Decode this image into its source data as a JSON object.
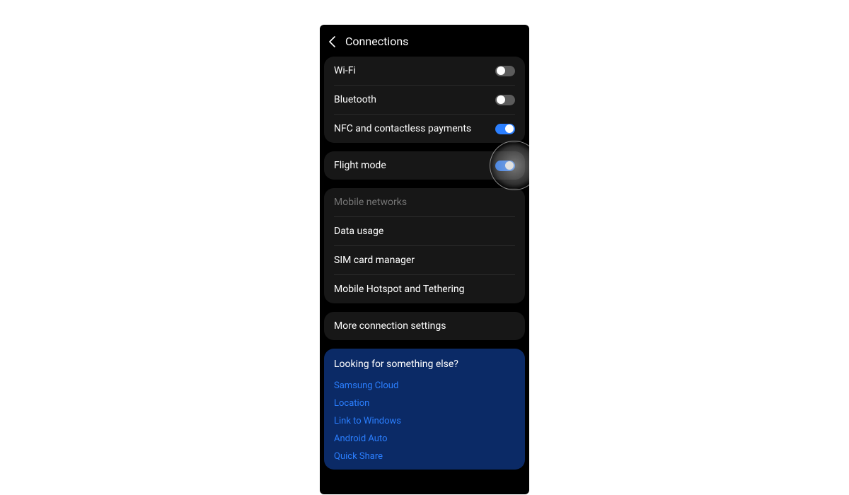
{
  "header": {
    "title": "Connections"
  },
  "groups": [
    {
      "rows": [
        {
          "label": "Wi-Fi",
          "toggle": true,
          "checked": false
        },
        {
          "label": "Bluetooth",
          "toggle": true,
          "checked": false
        },
        {
          "label": "NFC and contactless payments",
          "toggle": true,
          "checked": true
        }
      ]
    },
    {
      "rows": [
        {
          "label": "Flight mode",
          "toggle": true,
          "checked": true,
          "highlight": true
        }
      ]
    },
    {
      "rows": [
        {
          "label": "Mobile networks",
          "toggle": false,
          "disabled": true
        },
        {
          "label": "Data usage",
          "toggle": false
        },
        {
          "label": "SIM card manager",
          "toggle": false
        },
        {
          "label": "Mobile Hotspot and Tethering",
          "toggle": false
        }
      ]
    },
    {
      "rows": [
        {
          "label": "More connection settings",
          "toggle": false
        }
      ]
    }
  ],
  "suggest": {
    "title": "Looking for something else?",
    "links": [
      "Samsung Cloud",
      "Location",
      "Link to Windows",
      "Android Auto",
      "Quick Share"
    ]
  }
}
